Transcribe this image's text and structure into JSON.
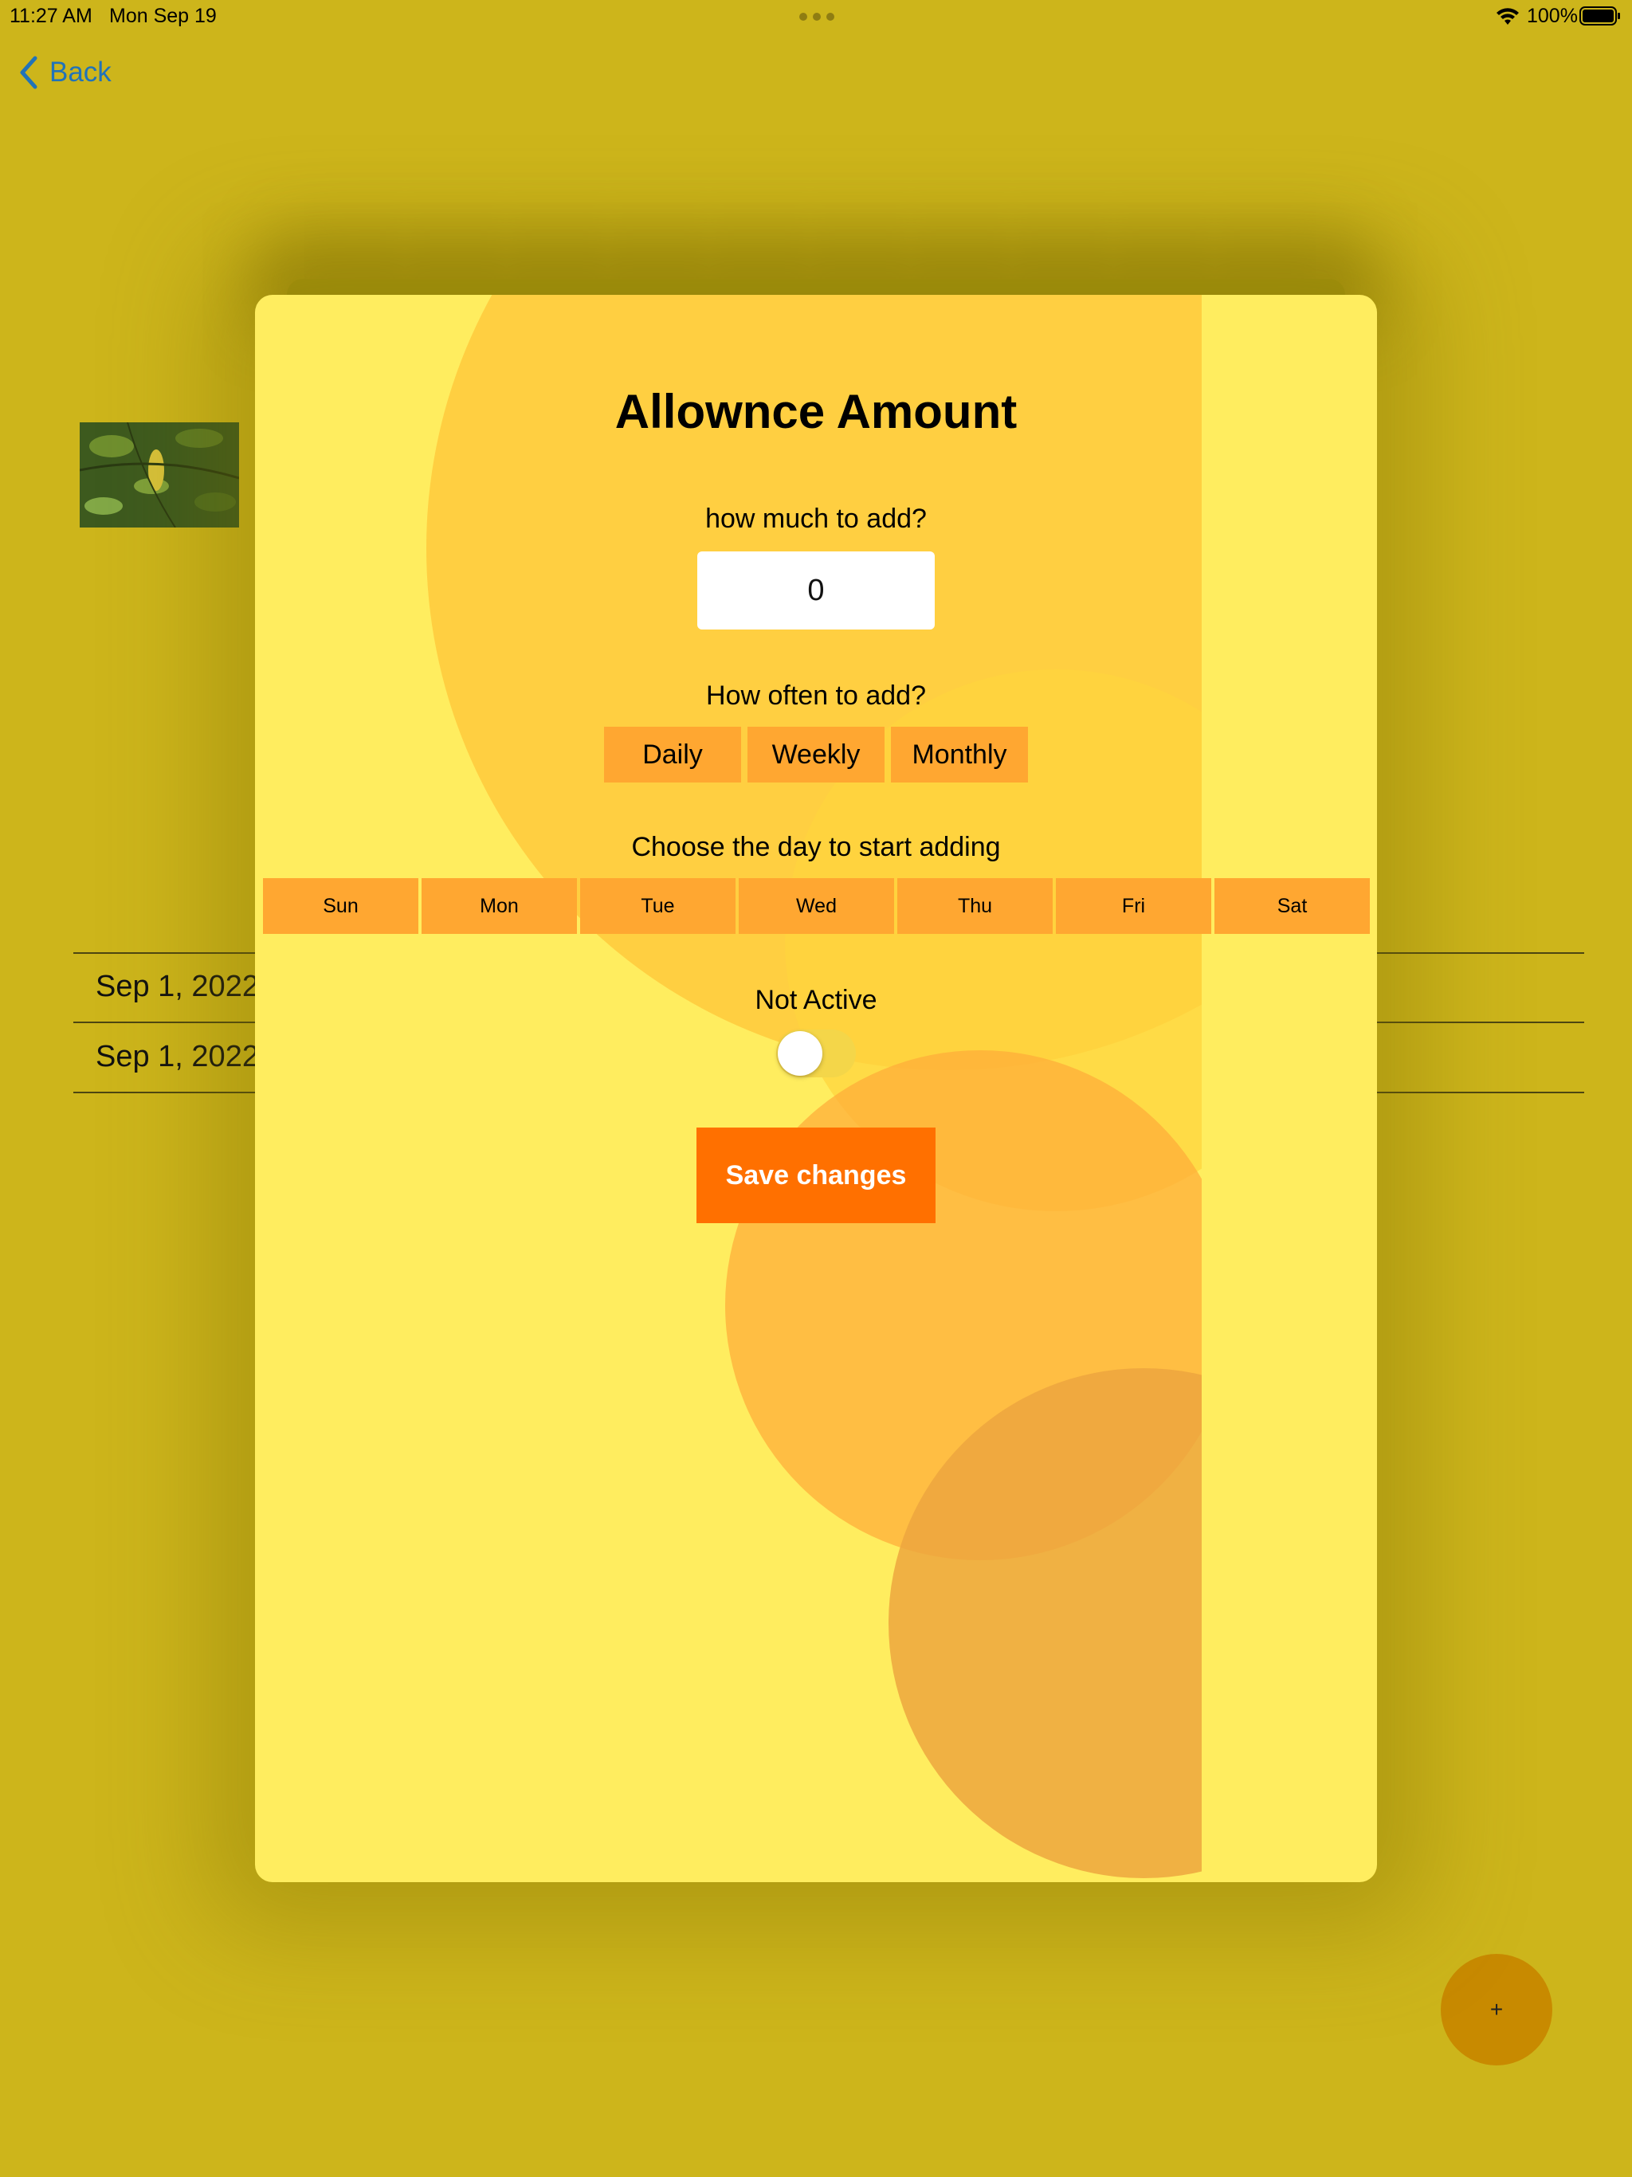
{
  "status_bar": {
    "time": "11:27 AM",
    "date": "Mon Sep 19",
    "battery": "100%",
    "wifi_icon": "wifi-icon",
    "battery_icon": "battery-icon"
  },
  "nav": {
    "back_label": "Back",
    "back_icon": "chevron-left-icon"
  },
  "background": {
    "rows": [
      {
        "date": "Sep 1, 2022"
      },
      {
        "date": "Sep 1, 2022"
      }
    ],
    "fab_label": "+"
  },
  "modal": {
    "title": "Allownce Amount",
    "amount_label": "how much to add?",
    "amount_value": "0",
    "frequency_label": "How often to add?",
    "frequency_options": [
      "Daily",
      "Weekly",
      "Monthly"
    ],
    "day_label": "Choose the day to start adding",
    "days": [
      "Sun",
      "Mon",
      "Tue",
      "Wed",
      "Thu",
      "Fri",
      "Sat"
    ],
    "status_label": "Not Active",
    "toggle_on": false,
    "save_label": "Save changes"
  },
  "colors": {
    "background": "#cdb51b",
    "modal": "#ffed5f",
    "option_button": "#ffa731",
    "save_button": "#ff7000",
    "link": "#2173b8",
    "fab": "#c88a00"
  }
}
